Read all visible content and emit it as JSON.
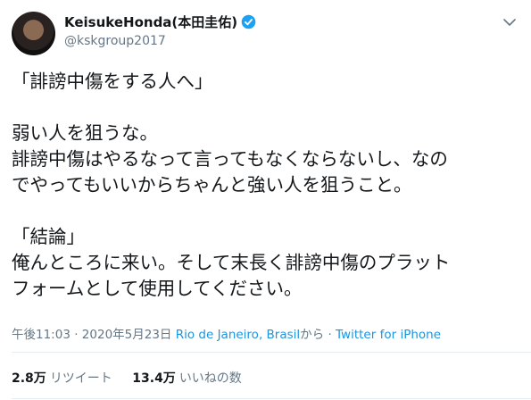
{
  "author": {
    "display_name": "KeisukeHonda(本田圭佑)",
    "handle": "@kskgroup2017",
    "verified_color": "#1da1f2"
  },
  "tweet": {
    "lines": [
      "「誹謗中傷をする人へ」",
      "",
      "弱い人を狙うな。",
      "誹謗中傷はやるなって言ってもなくならないし、なの",
      "でやってもいいからちゃんと強い人を狙うこと。",
      "",
      "「結論」",
      "俺んところに来い。そして末長く誹謗中傷のプラット",
      "フォームとして使用してください。"
    ]
  },
  "meta": {
    "time": "午後11:03",
    "separator": "·",
    "date": "2020年5月23日",
    "location": "Rio de Janeiro, Brasil",
    "from_suffix": "から",
    "source": "Twitter for iPhone"
  },
  "stats": {
    "retweets_value": "2.8万",
    "retweets_label": "リツイート",
    "likes_value": "13.4万",
    "likes_label": "いいねの数"
  },
  "colors": {
    "link": "#1b95e0",
    "muted": "#657786",
    "divider": "#e6ecf0"
  }
}
